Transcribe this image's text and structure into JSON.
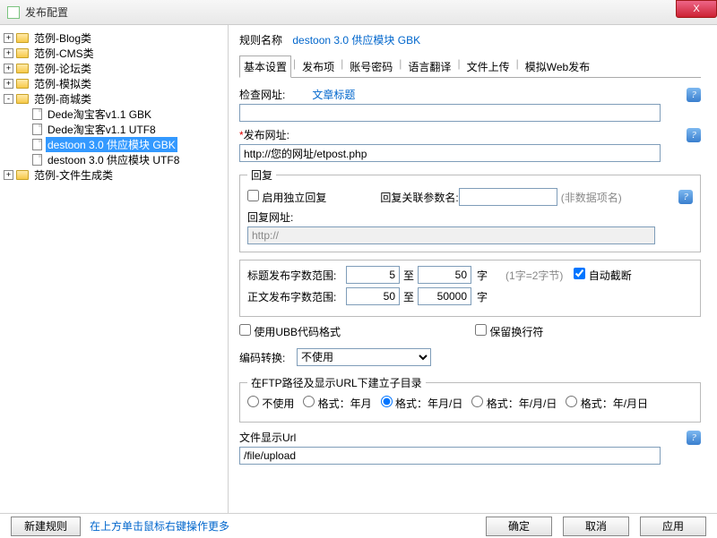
{
  "window": {
    "title": "发布配置",
    "close": "X"
  },
  "tree": {
    "items": [
      {
        "label": "范例-Blog类",
        "depth": 0,
        "toggle": "+",
        "type": "folder"
      },
      {
        "label": "范例-CMS类",
        "depth": 0,
        "toggle": "+",
        "type": "folder"
      },
      {
        "label": "范例-论坛类",
        "depth": 0,
        "toggle": "+",
        "type": "folder"
      },
      {
        "label": "范例-模拟类",
        "depth": 0,
        "toggle": "+",
        "type": "folder"
      },
      {
        "label": "范例-商城类",
        "depth": 0,
        "toggle": "-",
        "type": "folder"
      },
      {
        "label": "Dede淘宝客v1.1 GBK",
        "depth": 1,
        "toggle": "",
        "type": "file"
      },
      {
        "label": "Dede淘宝客v1.1 UTF8",
        "depth": 1,
        "toggle": "",
        "type": "file"
      },
      {
        "label": "destoon 3.0 供应模块 GBK",
        "depth": 1,
        "toggle": "",
        "type": "file",
        "selected": true
      },
      {
        "label": "destoon 3.0 供应模块 UTF8",
        "depth": 1,
        "toggle": "",
        "type": "file"
      },
      {
        "label": "范例-文件生成类",
        "depth": 0,
        "toggle": "+",
        "type": "folder"
      }
    ]
  },
  "rule": {
    "label": "规则名称",
    "value": "destoon 3.0 供应模块 GBK"
  },
  "tabs": [
    "基本设置",
    "发布项",
    "账号密码",
    "语言翻译",
    "文件上传",
    "模拟Web发布"
  ],
  "form": {
    "check_url_label": "检查网址:",
    "article_title": "文章标题",
    "check_url_value": "",
    "publish_url_label": "发布网址:",
    "publish_url_value": "http://您的网址/etpost.php",
    "reply": {
      "legend": "回复",
      "enable_label": "启用独立回复",
      "rel_param_label": "回复关联参数名:",
      "rel_param_value": "",
      "non_data_hint": "(非数据项名)",
      "reply_url_label": "回复网址:",
      "reply_url_value": "http://"
    },
    "range": {
      "title_label": "标题发布字数范围:",
      "title_min": "5",
      "title_max": "50",
      "to": "至",
      "unit": "字",
      "body_label": "正文发布字数范围:",
      "body_min": "50",
      "body_max": "50000",
      "note": "(1字=2字节)",
      "auto_trunc": "自动截断"
    },
    "ubb_label": "使用UBB代码格式",
    "keep_newline_label": "保留换行符",
    "encode_label": "编码转换:",
    "encode_value": "不使用",
    "ftp_legend": "在FTP路径及显示URL下建立子目录",
    "ftp_options": [
      "不使用",
      "格式：年月",
      "格式：年月/日",
      "格式：年/月/日",
      "格式：年/月日"
    ],
    "ftp_selected": 2,
    "file_url_label": "文件显示Url",
    "file_url_value": "/file/upload"
  },
  "bottom": {
    "new_rule": "新建规则",
    "hint": "在上方单击鼠标右键操作更多",
    "ok": "确定",
    "cancel": "取消",
    "apply": "应用"
  }
}
